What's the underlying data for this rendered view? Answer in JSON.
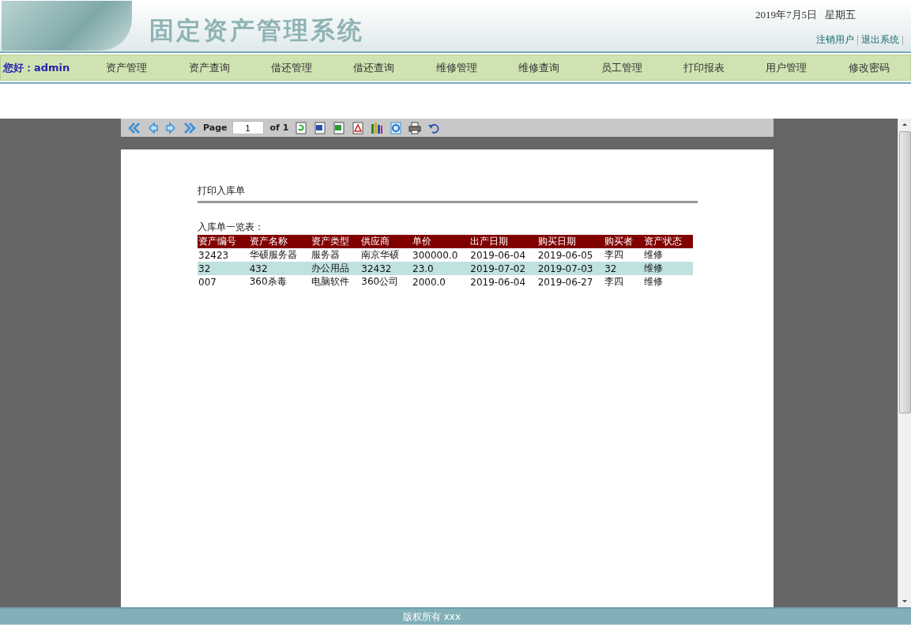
{
  "header": {
    "title": "固定资产管理系统",
    "date": "2019年7月5日",
    "weekday": "星期五",
    "links": [
      "注销用户",
      "退出系统"
    ]
  },
  "nav": {
    "greeting": "您好：admin",
    "items": [
      "资产管理",
      "资产查询",
      "借还管理",
      "借还查询",
      "维修管理",
      "维修查询",
      "员工管理",
      "打印报表",
      "用户管理",
      "修改密码"
    ]
  },
  "viewer": {
    "toolbar": {
      "page_label": "Page",
      "page_value": "1",
      "of_label": "of 1",
      "buttons": [
        {
          "kind": "first"
        },
        {
          "kind": "prev"
        },
        {
          "kind": "next"
        },
        {
          "kind": "last"
        },
        {
          "kind": "refresh"
        },
        {
          "kind": "word"
        },
        {
          "kind": "excel"
        },
        {
          "kind": "pdf"
        },
        {
          "kind": "books"
        },
        {
          "kind": "ie"
        },
        {
          "kind": "print"
        },
        {
          "kind": "undo"
        }
      ]
    },
    "report": {
      "title": "打印入库单",
      "subtitle": "入库单一览表：",
      "columns": [
        "资产编号",
        "资产名称",
        "资产类型",
        "供应商",
        "单价",
        "出产日期",
        "购买日期",
        "购买者",
        "资产状态"
      ],
      "rows": [
        [
          "32423",
          "华硕服务器",
          "服务器",
          "南京华硕",
          "300000.0",
          "2019-06-04",
          "2019-06-05",
          "李四",
          "维修"
        ],
        [
          "32",
          "432",
          "办公用品",
          "32432",
          "23.0",
          "2019-07-02",
          "2019-07-03",
          "32",
          "维修"
        ],
        [
          "007",
          "360杀毒",
          "电脑软件",
          "360公司",
          "2000.0",
          "2019-06-04",
          "2019-06-27",
          "李四",
          "维修"
        ]
      ]
    }
  },
  "footer": {
    "text": "版权所有 xxx"
  }
}
